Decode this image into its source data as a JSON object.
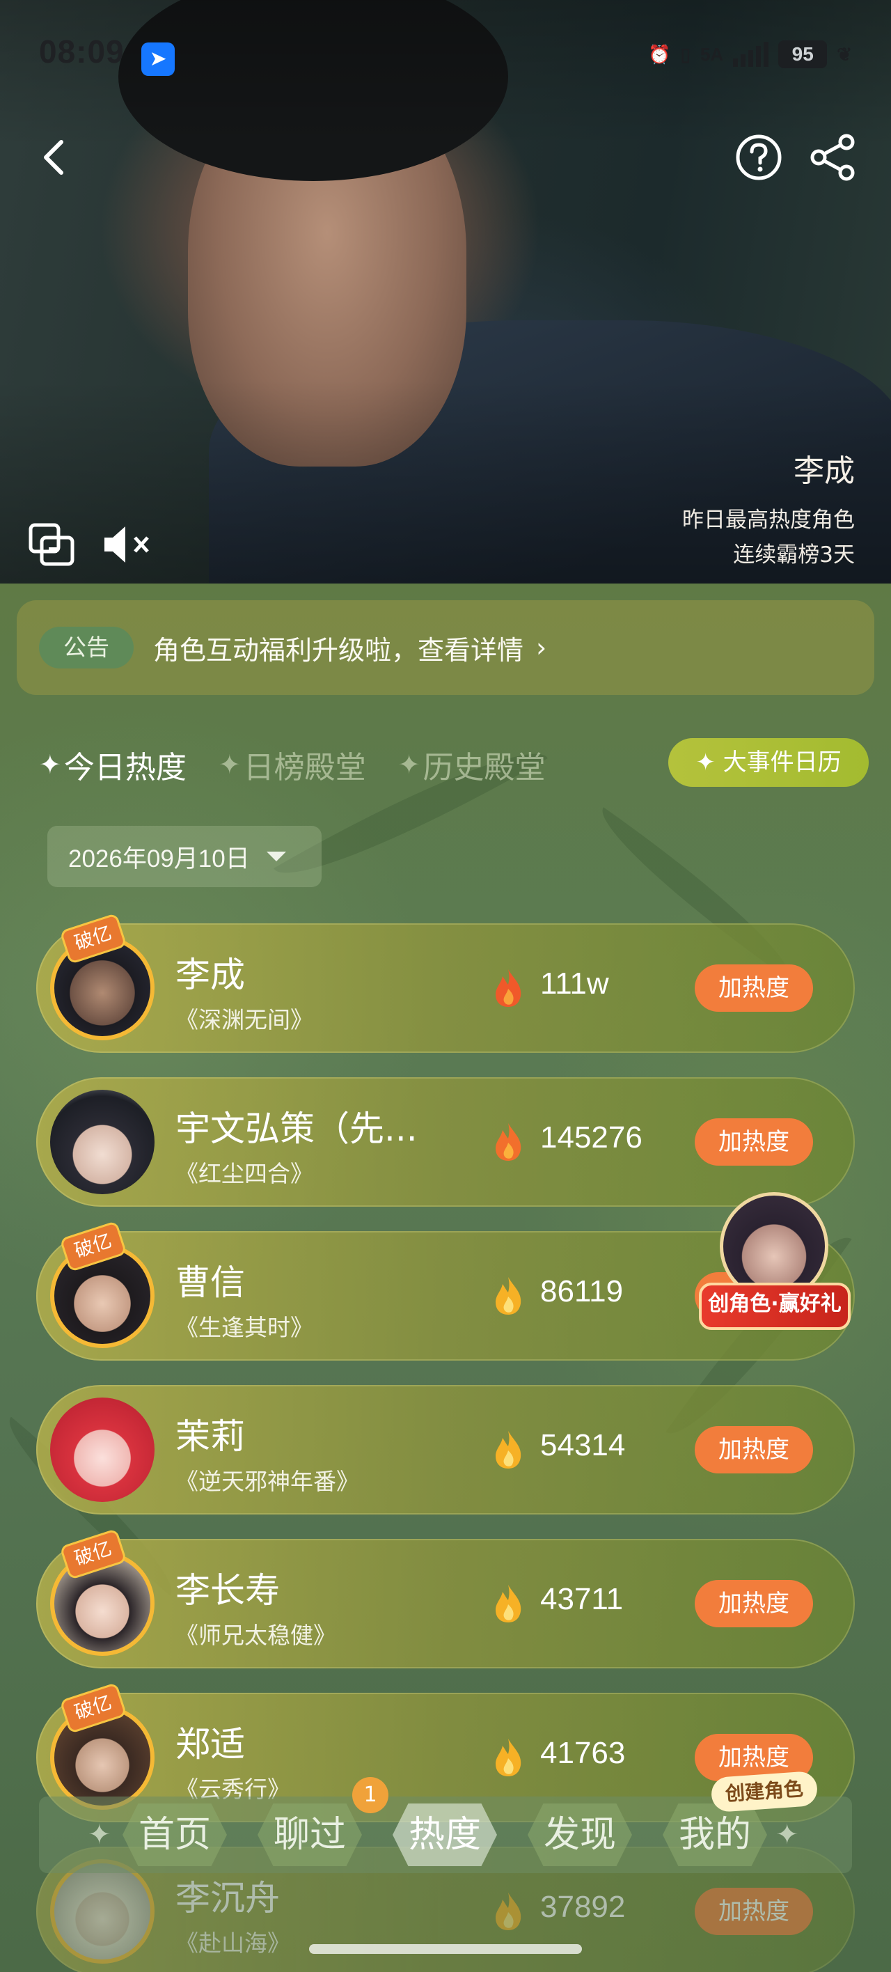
{
  "status_bar": {
    "time": "08:09",
    "network": "5A",
    "battery": "95"
  },
  "hero": {
    "character_name": "李成",
    "subtitle_1": "昨日最高热度角色",
    "subtitle_2": "连续霸榜3天"
  },
  "notice": {
    "tag": "公告",
    "text": "角色互动福利升级啦，查看详情",
    "arrow": "›"
  },
  "tabs": [
    {
      "label": "今日热度",
      "active": true
    },
    {
      "label": "日榜殿堂",
      "active": false
    },
    {
      "label": "历史殿堂",
      "active": false
    }
  ],
  "event_calendar_label": "✦ 大事件日历",
  "date_filter": "2026年09月10日",
  "boost_label": "加热度",
  "badge_label": "破亿",
  "rankings": [
    {
      "name": "李成",
      "work": "《深渊无间》",
      "heat": "111w",
      "badge": true
    },
    {
      "name": "宇文弘策（先...",
      "work": "《红尘四合》",
      "heat": "145276",
      "badge": false
    },
    {
      "name": "曹信",
      "work": "《生逢其时》",
      "heat": "86119",
      "badge": true
    },
    {
      "name": "茉莉",
      "work": "《逆天邪神年番》",
      "heat": "54314",
      "badge": false
    },
    {
      "name": "李长寿",
      "work": "《师兄太稳健》",
      "heat": "43711",
      "badge": true
    },
    {
      "name": "郑适",
      "work": "《云秀行》",
      "heat": "41763",
      "badge": true
    },
    {
      "name": "李沉舟",
      "work": "《赴山海》",
      "heat": "37892",
      "badge": true
    }
  ],
  "create_role_promo": "创角色·赢好礼",
  "bottom_nav": {
    "items": [
      {
        "label": "首页",
        "active": false
      },
      {
        "label": "聊过",
        "active": false
      },
      {
        "label": "热度",
        "active": true
      },
      {
        "label": "发现",
        "active": false
      },
      {
        "label": "我的",
        "active": false
      }
    ],
    "chat_badge": "1",
    "create_pill": "创建角色"
  },
  "colors": {
    "accent_orange": "#f27d3c",
    "gold_ring": "#f5b935",
    "event_button": "#a9be34"
  }
}
